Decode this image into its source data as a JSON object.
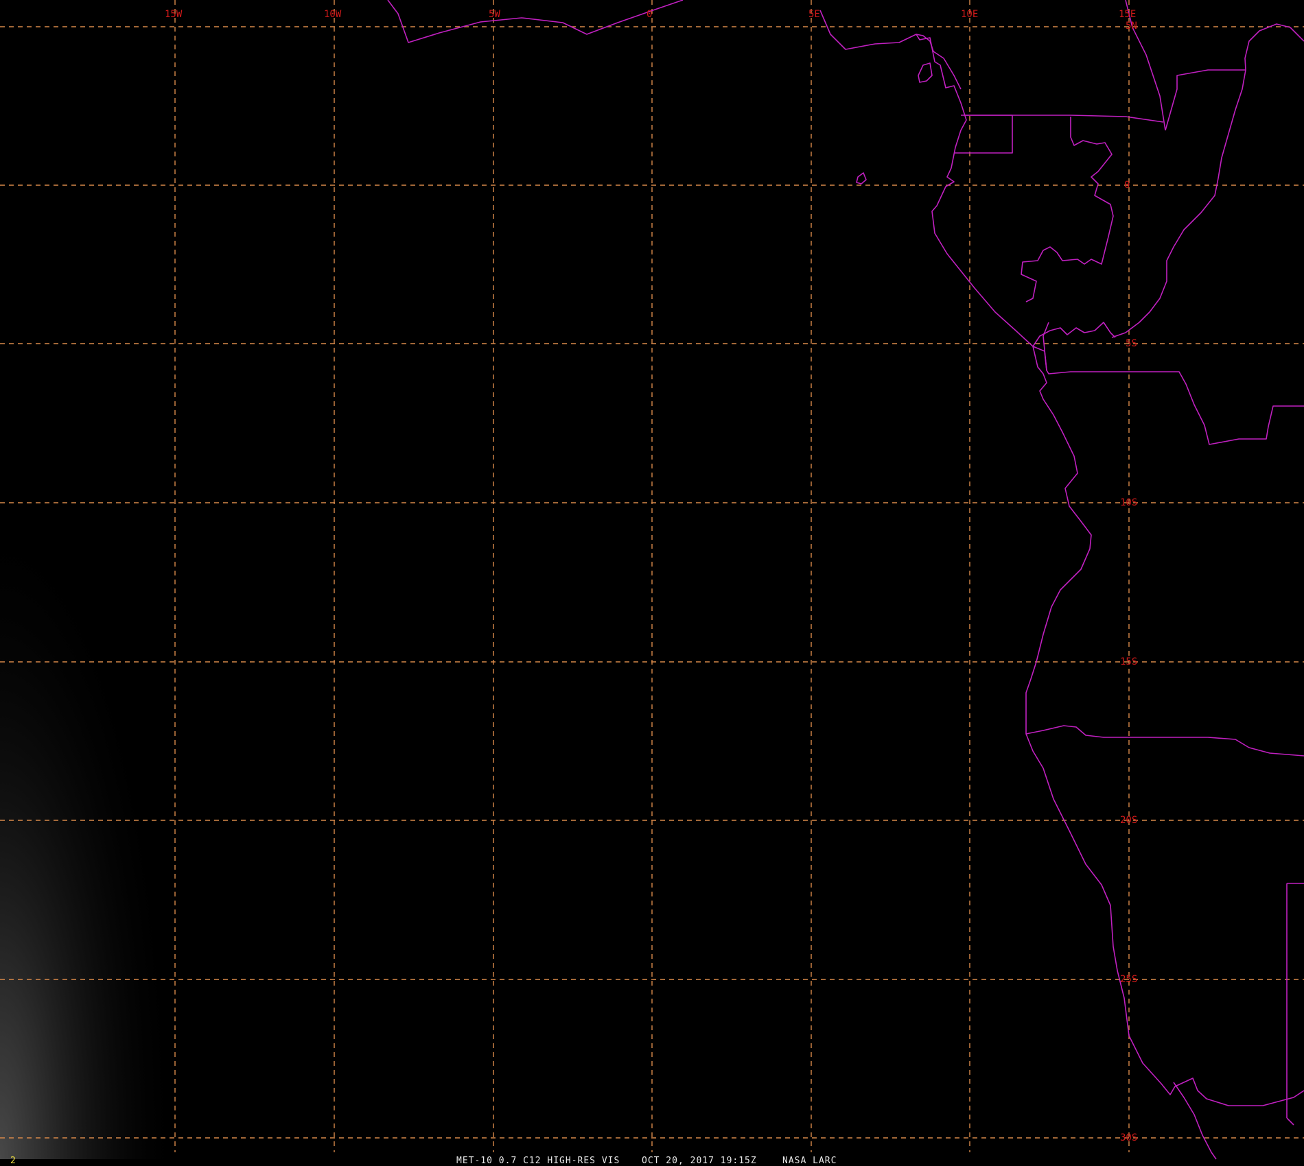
{
  "footer": {
    "satellite_label": "MET-10 0.7 C12 HIGH-RES VIS",
    "datetime": "OCT 20, 2017 19:15Z",
    "source": "NASA LARC",
    "frame_number": "2"
  },
  "map": {
    "lon_labels": [
      "15W",
      "10W",
      "5W",
      "0",
      "5E",
      "10E",
      "15E"
    ],
    "lat_labels": [
      "5N",
      "0",
      "5S",
      "10S",
      "15S",
      "20S",
      "25S",
      "30S"
    ],
    "colors": {
      "background": "#000000",
      "grid": "#d98a4a",
      "coastline": "#c020c0",
      "label": "#d21a1a",
      "footer_text": "#e8e8e8",
      "frame_text": "#f0e040"
    }
  }
}
